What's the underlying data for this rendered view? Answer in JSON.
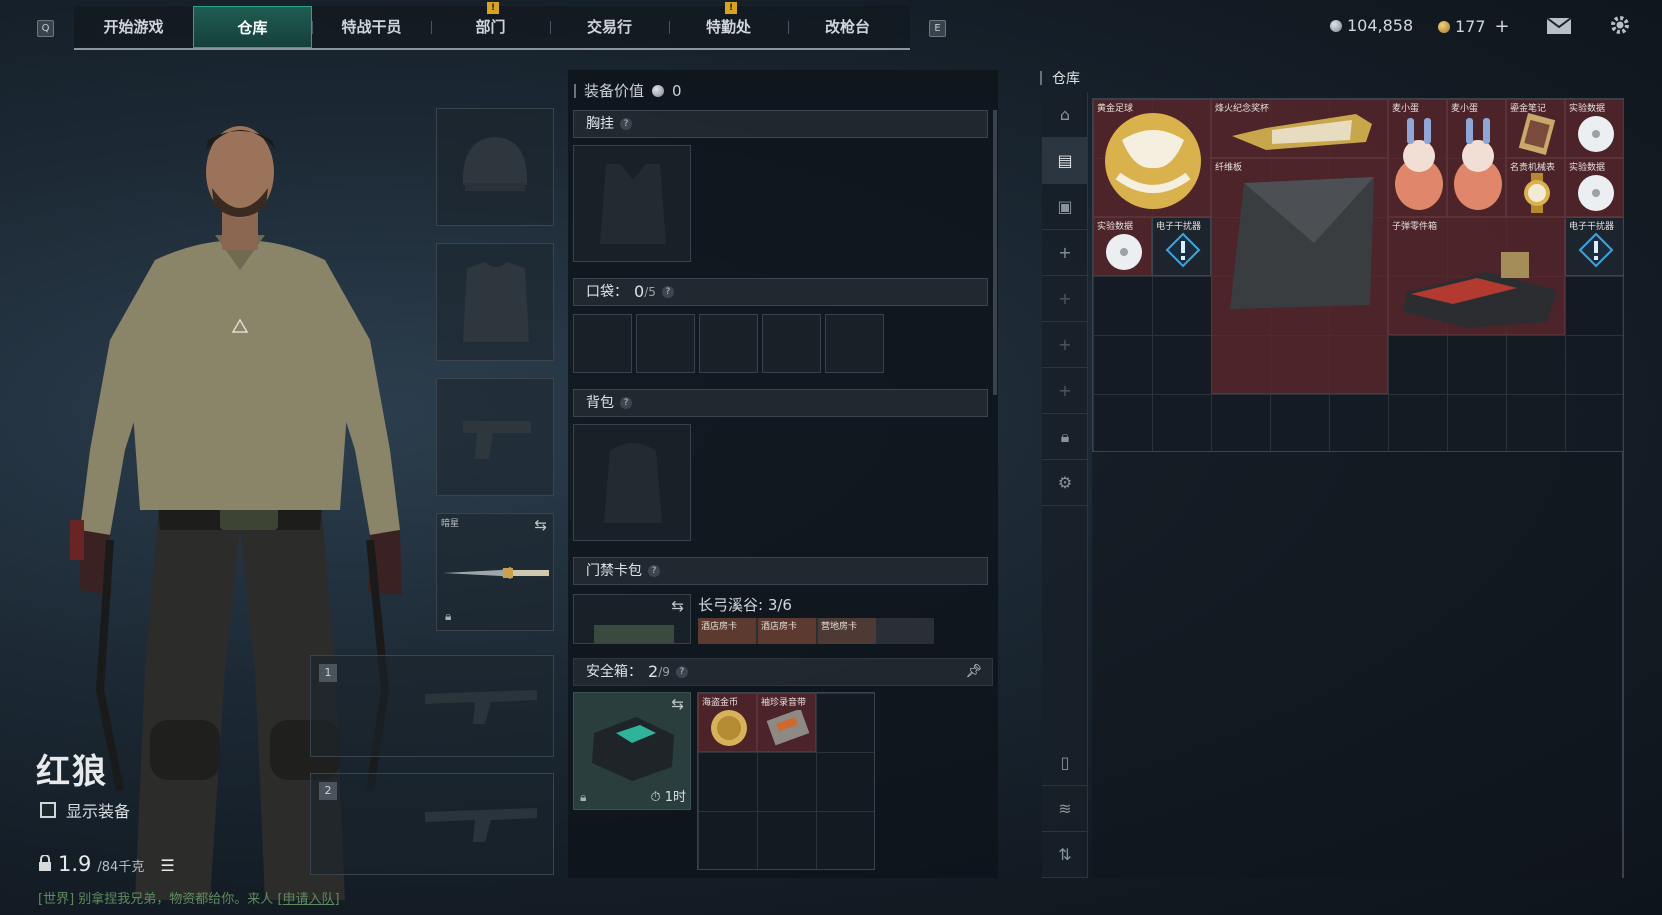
{
  "nav": {
    "key_left": "Q",
    "key_right": "E",
    "tabs": [
      {
        "label": "开始游戏"
      },
      {
        "label": "仓库"
      },
      {
        "label": "特战干员"
      },
      {
        "label": "部门",
        "alert": "!"
      },
      {
        "label": "交易行"
      },
      {
        "label": "特勤处",
        "alert": "!"
      },
      {
        "label": "改枪台"
      }
    ],
    "active_tab": "仓库"
  },
  "header": {
    "silver_amount": "104,858",
    "gold_amount": "177",
    "add_label": "+"
  },
  "character": {
    "name": "红狼",
    "show_gear_label": "显示装备",
    "weight_value": "1.9",
    "weight_max": "/84千克"
  },
  "chat": {
    "channel": "[世界]",
    "message": "别拿捏我兄弟，物资都给你。来人",
    "action": "[申请入队]"
  },
  "equipment": {
    "melee_label": "暗星",
    "weapon_slot_1": "1",
    "weapon_slot_2": "2"
  },
  "gear_panel": {
    "value_label": "装备价值",
    "value_amount": "0",
    "chest_rig": "胸挂",
    "pockets_label": "口袋：",
    "pockets_count": "0",
    "pockets_max": "/5",
    "backpack": "背包",
    "keycard_label": "门禁卡包",
    "keycard_map": "长弓溪谷: 3/6",
    "keycard_items": [
      "酒店房卡",
      "酒店房卡",
      "营地房卡"
    ],
    "safe_label": "安全箱：",
    "safe_count": "2",
    "safe_max": "/9",
    "safe_timer": "1时",
    "safe_items": [
      "海盗金币",
      "袖珍录音带"
    ]
  },
  "storage": {
    "title": "仓库",
    "items": [
      {
        "name": "黄金足球"
      },
      {
        "name": "烽火纪念奖杯"
      },
      {
        "name": "麦小蛋"
      },
      {
        "name": "麦小蛋"
      },
      {
        "name": "鎏金笔记"
      },
      {
        "name": "实验数据"
      },
      {
        "name": "纤维板"
      },
      {
        "name": "名贵机械表"
      },
      {
        "name": "实验数据"
      },
      {
        "name": "实验数据"
      },
      {
        "name": "电子干扰器"
      },
      {
        "name": "子弹零件箱"
      },
      {
        "name": "电子干扰器"
      }
    ]
  },
  "colors": {
    "accent_teal": "#2aa58b",
    "alert_yellow": "#d9a521",
    "rare_red": "#5c262c"
  }
}
